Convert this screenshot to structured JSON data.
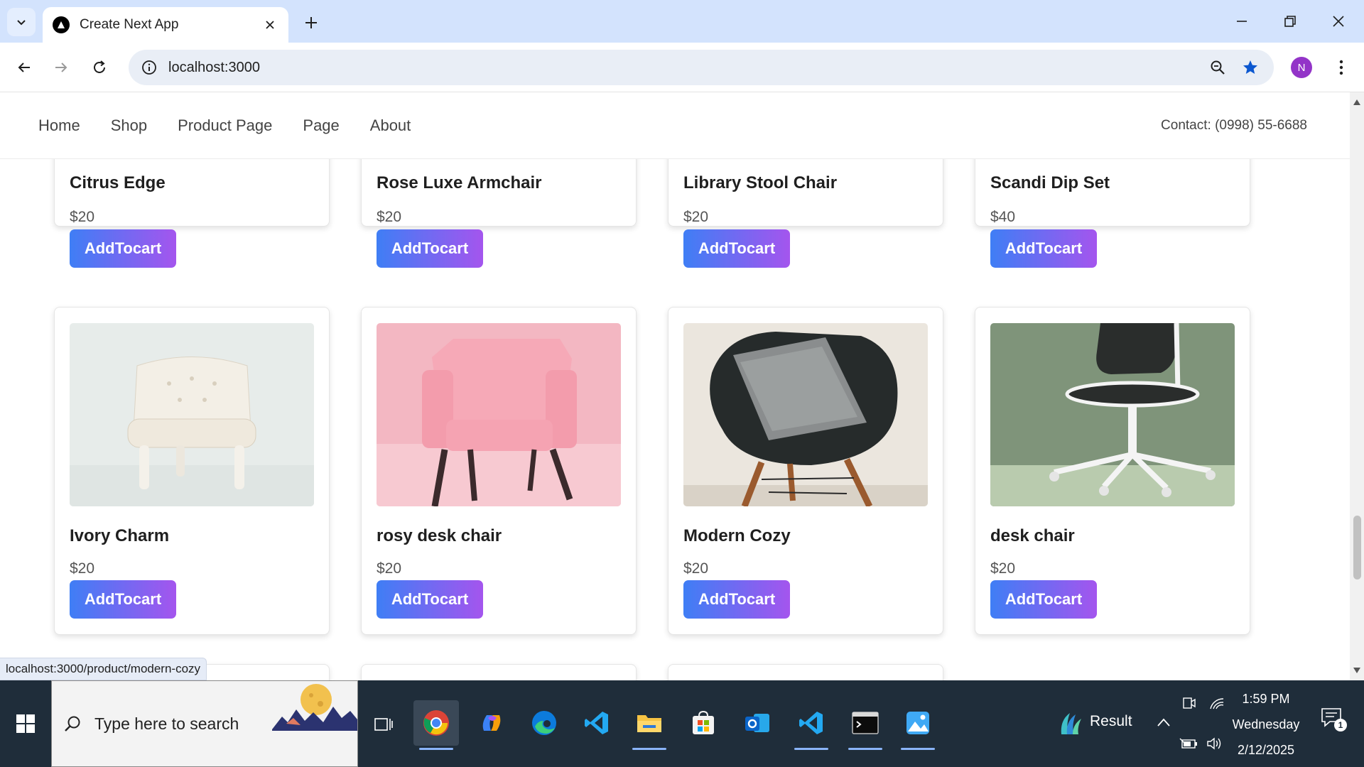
{
  "browser": {
    "tab_title": "Create Next App",
    "url": "localhost:3000",
    "profile_initial": "N",
    "status_url": "localhost:3000/product/modern-cozy"
  },
  "site": {
    "nav": [
      "Home",
      "Shop",
      "Product Page",
      "Page",
      "About"
    ],
    "contact": "Contact: (0998) 55-6688",
    "add_label": "AddTocart"
  },
  "products_row1": [
    {
      "name": "Citrus Edge",
      "price": "$20"
    },
    {
      "name": "Rose Luxe Armchair",
      "price": "$20"
    },
    {
      "name": "Library Stool Chair",
      "price": "$20"
    },
    {
      "name": "Scandi Dip Set",
      "price": "$40"
    }
  ],
  "products_row2": [
    {
      "name": "Ivory Charm",
      "price": "$20",
      "image": "white tufted chair"
    },
    {
      "name": "rosy desk chair",
      "price": "$20",
      "image": "pink armchair"
    },
    {
      "name": "Modern Cozy",
      "price": "$20",
      "image": "black shell chair with knit pillow"
    },
    {
      "name": "desk chair",
      "price": "$20",
      "image": "white office chair on green"
    }
  ],
  "taskbar": {
    "search_placeholder": "Type here to search",
    "weather_label": "Result",
    "time": "1:59 PM",
    "day": "Wednesday",
    "date": "2/12/2025",
    "notification_count": "1"
  },
  "colors": {
    "button_gradient_start": "#3f7ef5",
    "button_gradient_end": "#a455ee",
    "tabbar": "#d3e3fd",
    "taskbar": "#1f2d3a"
  }
}
